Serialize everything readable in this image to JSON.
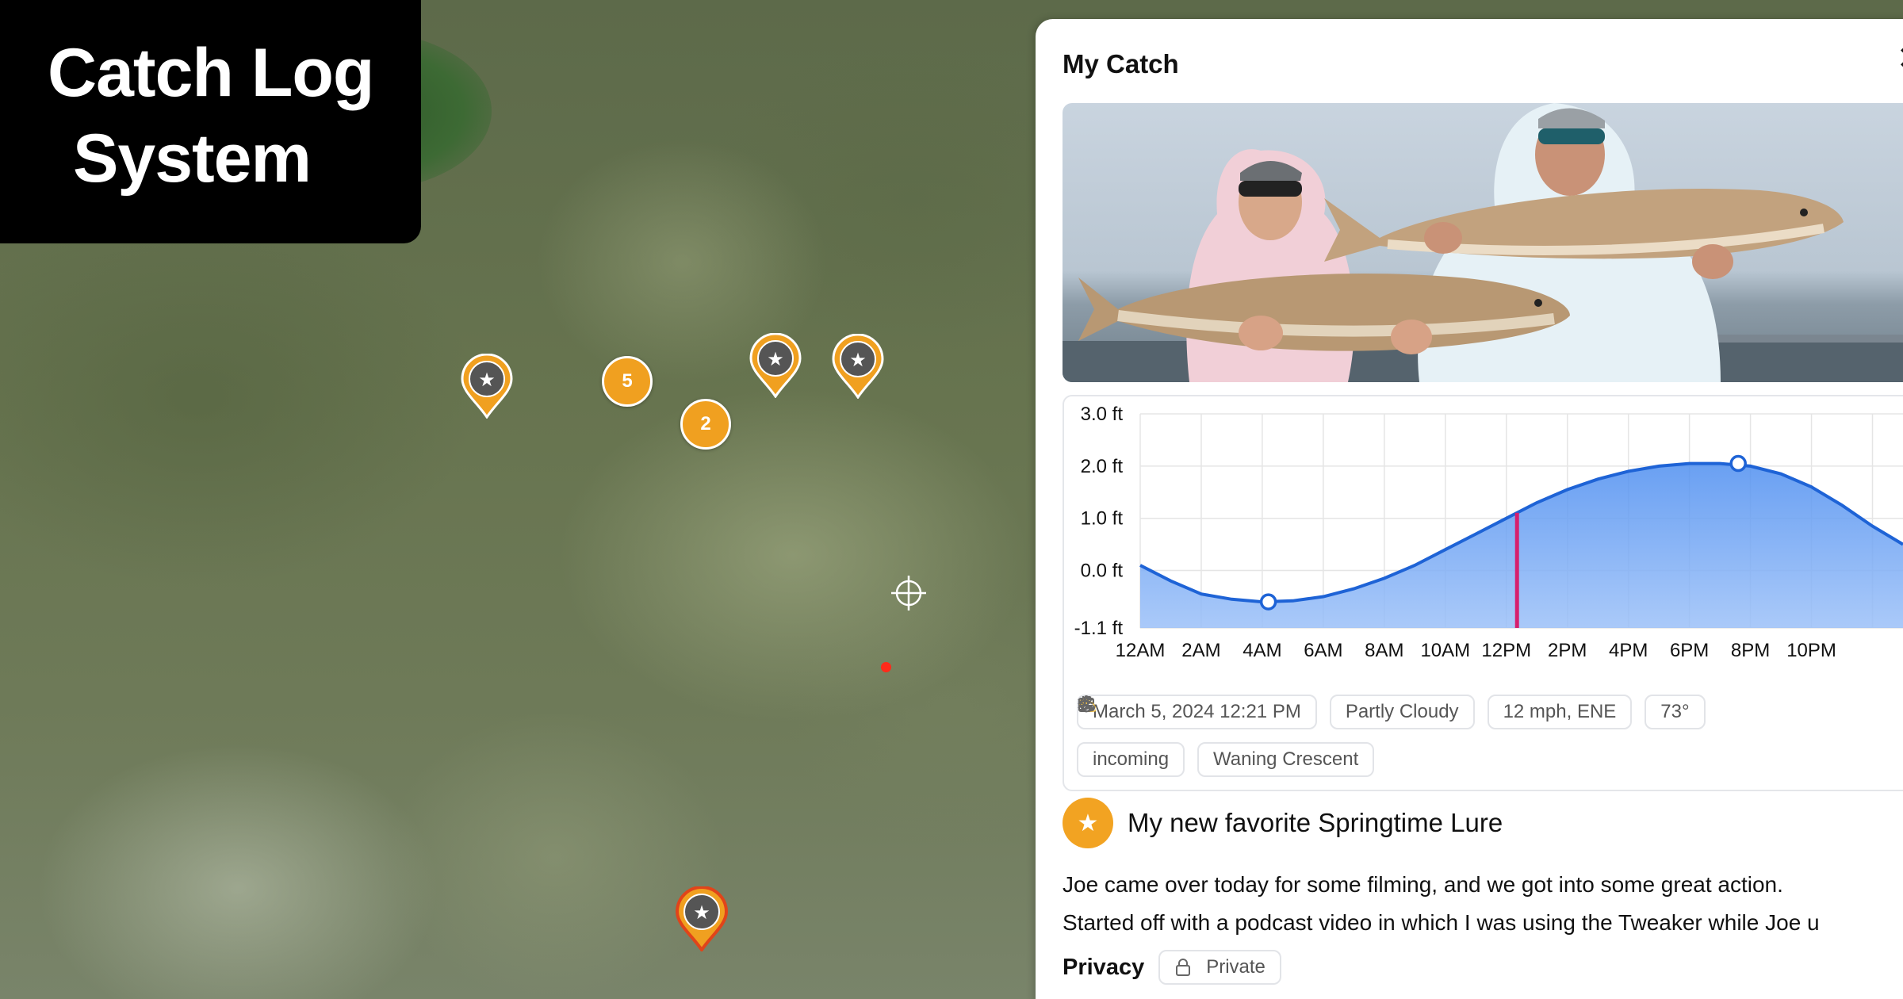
{
  "overlay": {
    "title_line1": "Catch Log",
    "title_line2": "System"
  },
  "map": {
    "clusters": [
      {
        "count": "5"
      },
      {
        "count": "2"
      }
    ],
    "colors": {
      "marker": "#f0a020",
      "selected_marker_ring": "#e0441a",
      "location_dot": "#ff2a1a"
    }
  },
  "panel": {
    "title": "My Catch",
    "close_icon": "close-icon",
    "tide_chart": {
      "chart_data": {
        "type": "area",
        "x_ticks": [
          "12AM",
          "2AM",
          "4AM",
          "6AM",
          "8AM",
          "10AM",
          "12PM",
          "2PM",
          "4PM",
          "6PM",
          "8PM",
          "10PM"
        ],
        "y_ticks": [
          "3.0 ft",
          "2.0 ft",
          "1.0 ft",
          "0.0 ft",
          "-1.1 ft"
        ],
        "ylim": [
          -1.1,
          3.0
        ],
        "xlim_hours": [
          0,
          25
        ],
        "series": [
          {
            "x": [
              0,
              1,
              2,
              3,
              4,
              5,
              6,
              7,
              8,
              9,
              10,
              11,
              12,
              13,
              14,
              15,
              16,
              17,
              18,
              19,
              20,
              21,
              22,
              23,
              24,
              25
            ],
            "y": [
              0.1,
              -0.2,
              -0.45,
              -0.55,
              -0.6,
              -0.58,
              -0.5,
              -0.35,
              -0.15,
              0.1,
              0.4,
              0.7,
              1.0,
              1.3,
              1.55,
              1.75,
              1.9,
              2.0,
              2.05,
              2.05,
              2.0,
              1.85,
              1.6,
              1.25,
              0.85,
              0.5
            ]
          }
        ],
        "markers": [
          {
            "label": "low",
            "x": 4.2,
            "y": -0.6
          },
          {
            "label": "high",
            "x": 19.6,
            "y": 2.05
          }
        ],
        "current_time_x": 12.35,
        "colors": {
          "line": "#1e63d6",
          "fill": "#80aef5",
          "current": "#d6206d",
          "grid": "#e5e5e5"
        }
      }
    },
    "chips": {
      "date": "March 5, 2024 12:21 PM",
      "weather": "Partly Cloudy",
      "wind": "12 mph, ENE",
      "temp": "73°",
      "tide": "incoming",
      "moon": "Waning Crescent"
    },
    "lure_title": "My new favorite Springtime Lure",
    "description_line1": "Joe came over today for some filming, and we got into some great action.",
    "description_line2": "Started off with a podcast video in which I was using the Tweaker while Joe u",
    "privacy_label": "Privacy",
    "privacy_value": "Private"
  }
}
